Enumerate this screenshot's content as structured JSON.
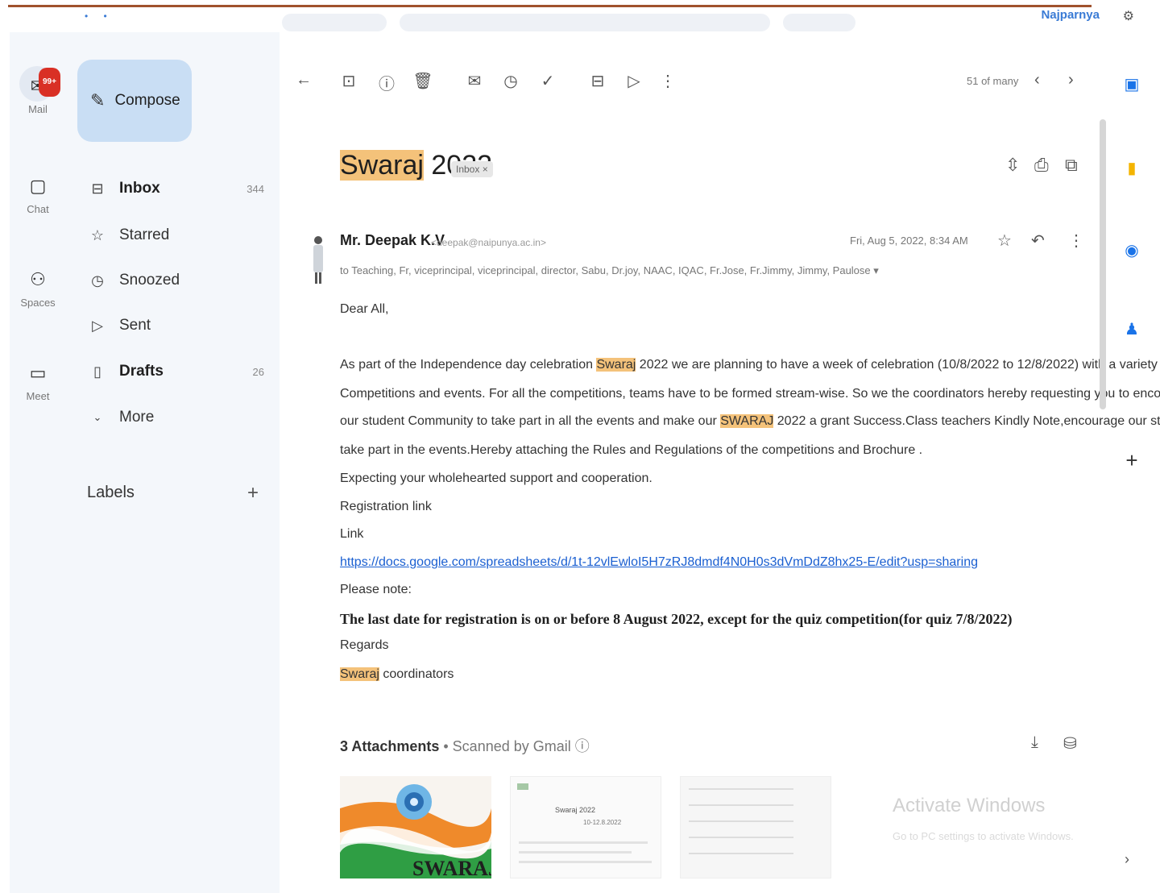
{
  "topbar": {
    "dots": "• •",
    "user": "Najparnya",
    "corner_icon": "settings-icon"
  },
  "rail": {
    "mail": {
      "label": "Mail",
      "badge": "99+",
      "icon": "mail-icon"
    },
    "chat": {
      "label": "Chat",
      "icon": "chat-icon"
    },
    "spaces": {
      "label": "Spaces",
      "icon": "spaces-icon"
    },
    "meet": {
      "label": "Meet",
      "icon": "meet-icon"
    }
  },
  "nav": {
    "compose": "Compose",
    "items": [
      {
        "label": "Inbox",
        "count": "344",
        "icon": "inbox-icon"
      },
      {
        "label": "Starred",
        "count": "",
        "icon": "star-icon"
      },
      {
        "label": "Snoozed",
        "count": "",
        "icon": "clock-icon"
      },
      {
        "label": "Sent",
        "count": "",
        "icon": "send-icon"
      },
      {
        "label": "Drafts",
        "count": "26",
        "icon": "draft-icon"
      },
      {
        "label": "More",
        "count": "",
        "icon": "chevron-down-icon"
      }
    ],
    "labels_heading": "Labels"
  },
  "toolbar": {
    "pager": "51 of many"
  },
  "message": {
    "subject_highlight": "Swaraj",
    "subject_rest": " 2022",
    "chip": "Inbox ×",
    "sender": "Mr. Deepak K.V",
    "sender_email": "<deepak@naipunya.ac.in>",
    "recipients": "to Teaching, Fr, viceprincipal, viceprincipal, director, Sabu, Dr.joy, NAAC, IQAC, Fr.Jose, Fr.Jimmy, Jimmy, Paulose ▾",
    "datetime": "Fri, Aug 5, 2022, 8:34 AM",
    "greeting": "Dear All,",
    "p1_pre": "As part of the Independence day celebration ",
    "p1_hl": "Swaraj",
    "p1_post": " 2022  we are planning to have a week of celebration (10/8/2022 to 12/8/2022)  with a variety of",
    "p2": "Competitions and events.  For all the competitions, teams have to be formed stream-wise. So we the coordinators hereby requesting you to encourage",
    "p3_pre": "our student Community to take part in all the events and make our ",
    "p3_hl": "SWARAJ",
    "p3_post": " 2022 a grant Success.Class teachers Kindly Note,encourage our students to",
    "p4": "take part in the events.Hereby attaching the Rules and Regulations of the competitions and Brochure .",
    "p5": "Expecting your wholehearted support and cooperation.",
    "p6": " Registration link",
    "p7": "Link",
    "link": "https://docs.google.com/spreadsheets/d/1t-12vlEwloI5H7zRJ8dmdf4N0H0s3dVmDdZ8hx25-E/edit?usp=sharing",
    "p8": "Please note:",
    "bold_note": "The last date for registration is on or before 8 August 2022, except for the quiz competition(for quiz 7/8/2022)",
    "regards": "Regards",
    "sign_hl": "Swaraj",
    "sign_rest": " coordinators"
  },
  "attachments": {
    "count_label": "3 Attachments",
    "scanned": " • Scanned by Gmail ⓘ",
    "thumb1_caption": "SWARAJ",
    "thumb2_title": "Swaraj 2022",
    "thumb2_sub": "10-12.8.2022"
  },
  "watermark": {
    "title": "Activate Windows",
    "sub": "Go to PC settings to activate Windows."
  },
  "colors": {
    "highlight": "#f4c27a",
    "accent": "#1a5fd1",
    "compose_bg": "#c9def4",
    "badge": "#d93025"
  }
}
